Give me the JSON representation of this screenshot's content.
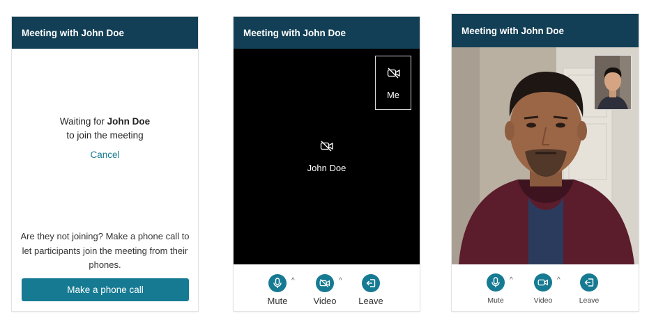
{
  "panel1": {
    "title": "Meeting with John Doe",
    "waiting_prefix": "Waiting for ",
    "waiting_name": "John Doe",
    "waiting_suffix": "to join the meeting",
    "cancel_label": "Cancel",
    "note": "Are they not joining? Make a phone call to let participants join the meeting from their phones.",
    "call_button_label": "Make a phone call"
  },
  "panel2": {
    "title": "Meeting with John Doe",
    "self_tile": {
      "label": "Me",
      "icon": "video-off-icon"
    },
    "remote_tile": {
      "label": "John Doe",
      "icon": "video-off-icon"
    },
    "controls": [
      {
        "label": "Mute",
        "icon": "microphone-icon"
      },
      {
        "label": "Video",
        "icon": "video-off-icon"
      },
      {
        "label": "Leave",
        "icon": "leave-icon"
      }
    ]
  },
  "panel3": {
    "title": "Meeting with John Doe",
    "controls": [
      {
        "label": "Mute",
        "icon": "microphone-icon"
      },
      {
        "label": "Video",
        "icon": "video-icon"
      },
      {
        "label": "Leave",
        "icon": "leave-icon"
      }
    ]
  },
  "colors": {
    "header": "#123f55",
    "accent": "#167a92",
    "link": "#177a90",
    "stage": "#000000"
  }
}
